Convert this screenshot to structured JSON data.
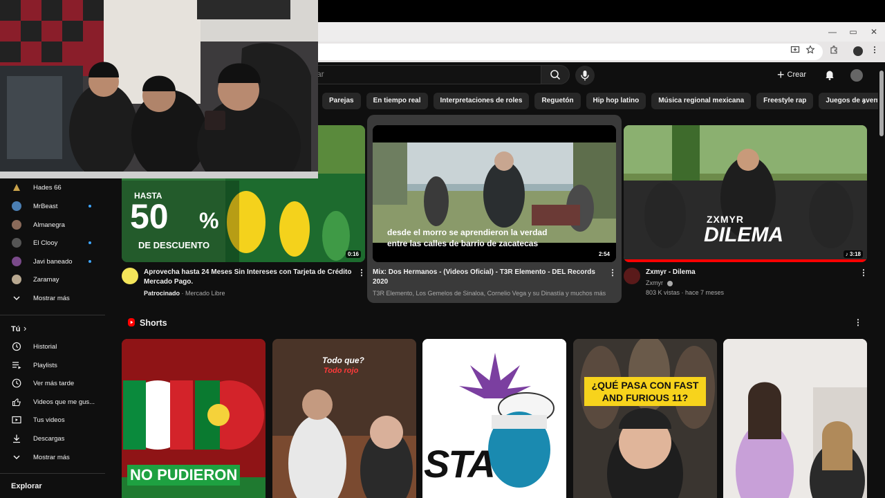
{
  "browser": {
    "window_controls": [
      "—",
      "▭",
      "✕"
    ]
  },
  "header": {
    "search_placeholder": "ar",
    "create_label": "Crear"
  },
  "chips": [
    "Parejas",
    "En tiempo real",
    "Interpretaciones de roles",
    "Reguetón",
    "Hip hop latino",
    "Música regional mexicana",
    "Freestyle rap",
    "Juegos de aventura y acción"
  ],
  "sidebar": {
    "subscriptions": [
      {
        "name": "Hades 66",
        "dot": false,
        "color": "#2a2418"
      },
      {
        "name": "MrBeast",
        "dot": true,
        "color": "#4b7fb3"
      },
      {
        "name": "Almanegra",
        "dot": false,
        "color": "#8a6a5a"
      },
      {
        "name": "El Clooy",
        "dot": true,
        "color": "#555555"
      },
      {
        "name": "Javi baneado",
        "dot": true,
        "color": "#7a4a8a"
      },
      {
        "name": "Zaramay",
        "dot": false,
        "color": "#b8a890"
      }
    ],
    "show_more": "Mostrar más",
    "you_header": "Tú",
    "you_items": [
      {
        "label": "Historial",
        "icon": "history-icon"
      },
      {
        "label": "Playlists",
        "icon": "playlists-icon"
      },
      {
        "label": "Ver más tarde",
        "icon": "clock-icon"
      },
      {
        "label": "Videos que me gus...",
        "icon": "thumb-up-icon"
      },
      {
        "label": "Tus videos",
        "icon": "your-videos-icon"
      },
      {
        "label": "Descargas",
        "icon": "download-icon"
      }
    ],
    "show_more_2": "Mostrar más",
    "explore_header": "Explorar"
  },
  "videos": [
    {
      "title": "Aprovecha hasta 24 Meses Sin Intereses con Tarjeta de Crédito Mercado Pago.",
      "meta_strong": "Patrocinado",
      "meta": " · Mercado Libre",
      "duration": "0:16",
      "promo_top": "HASTA",
      "promo_big": "50",
      "promo_pct": "%",
      "promo_bottom": "DE DESCUENTO"
    },
    {
      "title": "Mix: Dos Hermanos - (Videos Oficial) - T3R Elemento - DEL Records 2020",
      "meta": "T3R Elemento, Los Gemelos de Sinaloa, Cornelio Vega y su Dinastía y muchos más",
      "duration": "2:54",
      "caption_1": "desde el morro se aprendieron la verdad",
      "caption_2": "entre las calles de barrio de zacatecas"
    },
    {
      "title": "Zxmyr - Dilema",
      "channel": "Zxmyr",
      "meta": "803 K vistas · hace 7 meses",
      "duration": "♪ 3:18",
      "overlay_1": "ZXMYR",
      "overlay_2": "DILEMA"
    }
  ],
  "shorts": {
    "title": "Shorts",
    "items": [
      {
        "overlay": "NO PUDIERON"
      },
      {
        "overlay_1": "Todo que?",
        "overlay_2": "Todo rojo"
      },
      {
        "overlay": "STA"
      },
      {
        "overlay": "¿QUÉ PASA CON FAST AND FURIOUS 11?"
      },
      {
        "overlay": ""
      }
    ]
  },
  "colors": {
    "background": "#0f0f0f",
    "chip": "#272727",
    "accent_red": "#ff0000",
    "link_blue": "#3ea6ff"
  }
}
